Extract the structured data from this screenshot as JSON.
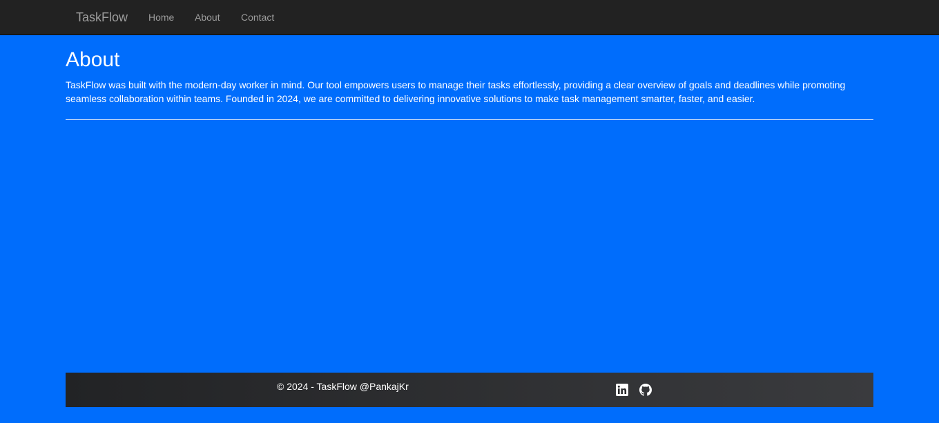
{
  "navbar": {
    "brand": "TaskFlow",
    "links": [
      {
        "label": "Home"
      },
      {
        "label": "About"
      },
      {
        "label": "Contact"
      }
    ]
  },
  "main": {
    "title": "About",
    "description": "TaskFlow was built with the modern-day worker in mind. Our tool empowers users to manage their tasks effortlessly, providing a clear overview of goals and deadlines while promoting seamless collaboration within teams. Founded in 2024, we are committed to delivering innovative solutions to make task management smarter, faster, and easier."
  },
  "footer": {
    "copyright": "© 2024 - TaskFlow @PankajKr",
    "social_icons": [
      "linkedin-icon",
      "github-icon"
    ]
  },
  "colors": {
    "page_background": "#006dfc",
    "navbar_background": "#222222",
    "nav_text": "#9d9d9d",
    "footer_background": "#2b2c2e",
    "text": "#ffffff"
  }
}
